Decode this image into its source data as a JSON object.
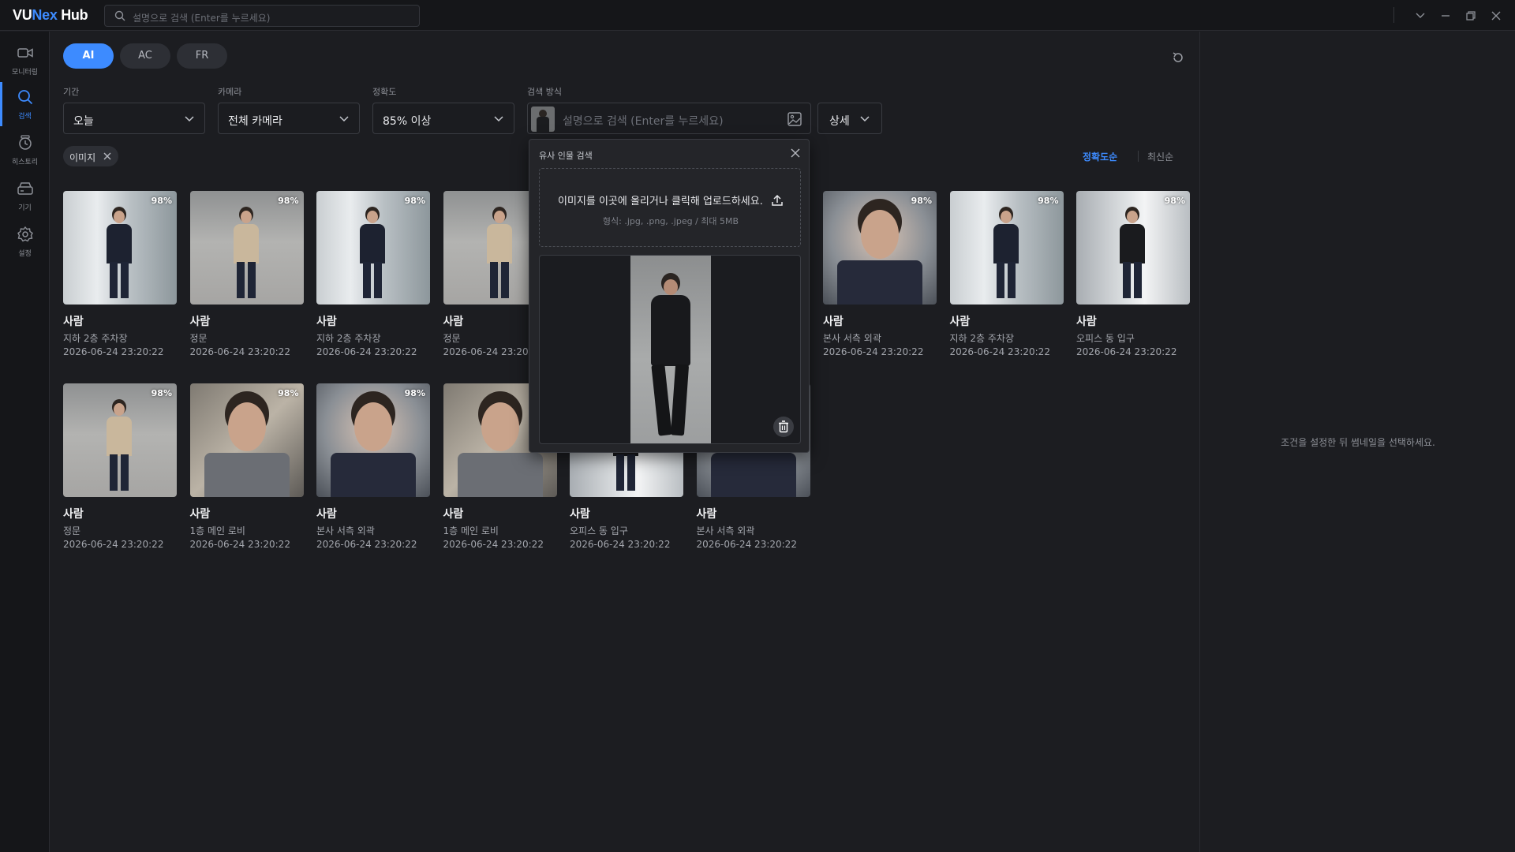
{
  "app": {
    "logo_v": "VU",
    "logo_nex": "Nex",
    "logo_hub": " Hub"
  },
  "topbar": {
    "search_placeholder": "설명으로 검색 (Enter를 누르세요)"
  },
  "sidebar": {
    "items": [
      {
        "label": "모니터링",
        "icon": "video-camera-icon"
      },
      {
        "label": "검색",
        "icon": "search-icon",
        "active": true
      },
      {
        "label": "히스토리",
        "icon": "history-icon"
      },
      {
        "label": "기기",
        "icon": "device-icon"
      },
      {
        "label": "설정",
        "icon": "gear-icon"
      }
    ]
  },
  "tabs": [
    {
      "label": "AI",
      "active": true
    },
    {
      "label": "AC"
    },
    {
      "label": "FR"
    }
  ],
  "filters": {
    "period": {
      "label": "기간",
      "value": "오늘"
    },
    "camera": {
      "label": "카메라",
      "value": "전체 카메라"
    },
    "accuracy": {
      "label": "정확도",
      "value": "85% 이상"
    },
    "method": {
      "label": "검색 방식",
      "placeholder": "설명으로 검색 (Enter를 누르세요)"
    },
    "detail": {
      "label": "상세"
    }
  },
  "chip": {
    "label": "이미지"
  },
  "sort": {
    "accuracy": "정확도순",
    "latest": "최신순"
  },
  "popup": {
    "title": "유사 인물 검색",
    "drop_text": "이미지를 이곳에 올리거나 클릭해 업로드하세요.",
    "format_text": "형식: .jpg, .png, .jpeg / 최대 5MB"
  },
  "right_pane": {
    "message": "조건을 설정한 뒤 썸네일을 선택하세요."
  },
  "results": [
    {
      "type": "사람",
      "location": "지하 2층 주차장",
      "time": "2026-06-24 23:20:22",
      "score": "98%",
      "photo": "hall-suit"
    },
    {
      "type": "사람",
      "location": "정문",
      "time": "2026-06-24 23:20:22",
      "score": "98%",
      "photo": "street"
    },
    {
      "type": "사람",
      "location": "지하 2층 주차장",
      "time": "2026-06-24 23:20:22",
      "score": "98%",
      "photo": "hall-suit"
    },
    {
      "type": "사람",
      "location": "정문",
      "time": "2026-06-24 23:20:22",
      "score": "",
      "photo": "street"
    },
    {
      "type": "사람",
      "location": "본사 서측 외곽",
      "time": "2026-06-24 23:20:22",
      "score": "98%",
      "photo": "portrait"
    },
    {
      "type": "사람",
      "location": "지하 2층 주차장",
      "time": "2026-06-24 23:20:22",
      "score": "98%",
      "photo": "hall-suit"
    },
    {
      "type": "사람",
      "location": "오피스 동 입구",
      "time": "2026-06-24 23:20:22",
      "score": "98%",
      "photo": "office"
    },
    {
      "type": "사람",
      "location": "정문",
      "time": "2026-06-24 23:20:22",
      "score": "98%",
      "photo": "street"
    },
    {
      "type": "사람",
      "location": "1층 메인 로비",
      "time": "2026-06-24 23:20:22",
      "score": "98%",
      "photo": "lobby"
    },
    {
      "type": "사람",
      "location": "본사 서측 외곽",
      "time": "2026-06-24 23:20:22",
      "score": "98%",
      "photo": "portrait"
    },
    {
      "type": "사람",
      "location": "1층 메인 로비",
      "time": "2026-06-24 23:20:22",
      "score": "",
      "photo": "lobby"
    },
    {
      "type": "사람",
      "location": "오피스 동 입구",
      "time": "2026-06-24 23:20:22",
      "score": "",
      "photo": "office"
    },
    {
      "type": "사람",
      "location": "본사 서측 외곽",
      "time": "2026-06-24 23:20:22",
      "score": "",
      "photo": "portrait"
    }
  ],
  "colors": {
    "accent": "#3d8bff",
    "bg": "#1c1d21",
    "panel": "#151619"
  }
}
